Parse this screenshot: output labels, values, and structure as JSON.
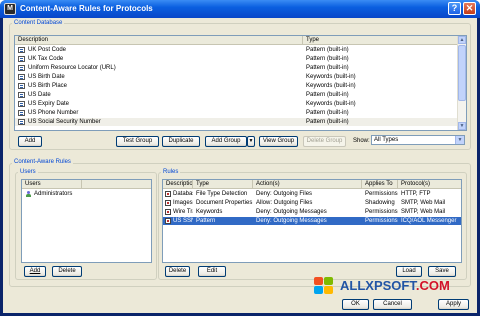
{
  "window": {
    "title": "Content-Aware Rules for Protocols",
    "help": "?",
    "close": "✕"
  },
  "content_database": {
    "group_label": "Content Database",
    "columns": [
      "Description",
      "Type"
    ],
    "rows": [
      {
        "description": "UK Post Code",
        "type": "Pattern (built-in)"
      },
      {
        "description": "UK Tax Code",
        "type": "Pattern (built-in)"
      },
      {
        "description": "Uniform Resource Locator (URL)",
        "type": "Pattern (built-in)"
      },
      {
        "description": "US Birth Date",
        "type": "Keywords (built-in)"
      },
      {
        "description": "US Birth Place",
        "type": "Keywords (built-in)"
      },
      {
        "description": "US Date",
        "type": "Pattern (built-in)"
      },
      {
        "description": "US Expiry Date",
        "type": "Keywords (built-in)"
      },
      {
        "description": "US Phone Number",
        "type": "Pattern (built-in)"
      },
      {
        "description": "US Social Security Number",
        "type": "Pattern (built-in)"
      }
    ],
    "add": "Add",
    "test_group": "Test Group",
    "duplicate": "Duplicate",
    "add_group": "Add Group",
    "view_group": "View Group",
    "delete_group": "Delete Group",
    "show_label": "Show:",
    "show_value": "All Types"
  },
  "rules_section": {
    "group_label": "Content-Aware Rules"
  },
  "users": {
    "group_label": "Users",
    "column": "Users",
    "rows": [
      "Administrators"
    ],
    "add": "Add",
    "delete": "Delete"
  },
  "rules": {
    "group_label": "Rules",
    "columns": [
      "Description",
      "Type",
      "Action(s)",
      "Applies To",
      "Protocol(s)"
    ],
    "rows": [
      {
        "description": "Database",
        "type": "File Type Detection",
        "actions": "Deny: Outgoing Files",
        "applies": "Permissions",
        "protocols": "HTTP, FTP"
      },
      {
        "description": "Images with text",
        "type": "Document Properties",
        "actions": "Allow: Outgoing Files",
        "applies": "Shadowing",
        "protocols": "SMTP, Web Mail"
      },
      {
        "description": "Wire Transfer",
        "type": "Keywords",
        "actions": "Deny: Outgoing Messages",
        "applies": "Permissions",
        "protocols": "SMTP, Web Mail"
      },
      {
        "description": "US SSN",
        "type": "Pattern",
        "actions": "Deny: Outgoing Messages",
        "applies": "Permissions",
        "protocols": "ICQ/AOL Messenger"
      }
    ],
    "delete": "Delete",
    "edit": "Edit",
    "load": "Load",
    "save": "Save"
  },
  "footer": {
    "ok": "OK",
    "cancel": "Cancel",
    "apply": "Apply"
  },
  "watermark": {
    "brand": "ALLXPSOFT",
    "tld": ".COM"
  }
}
